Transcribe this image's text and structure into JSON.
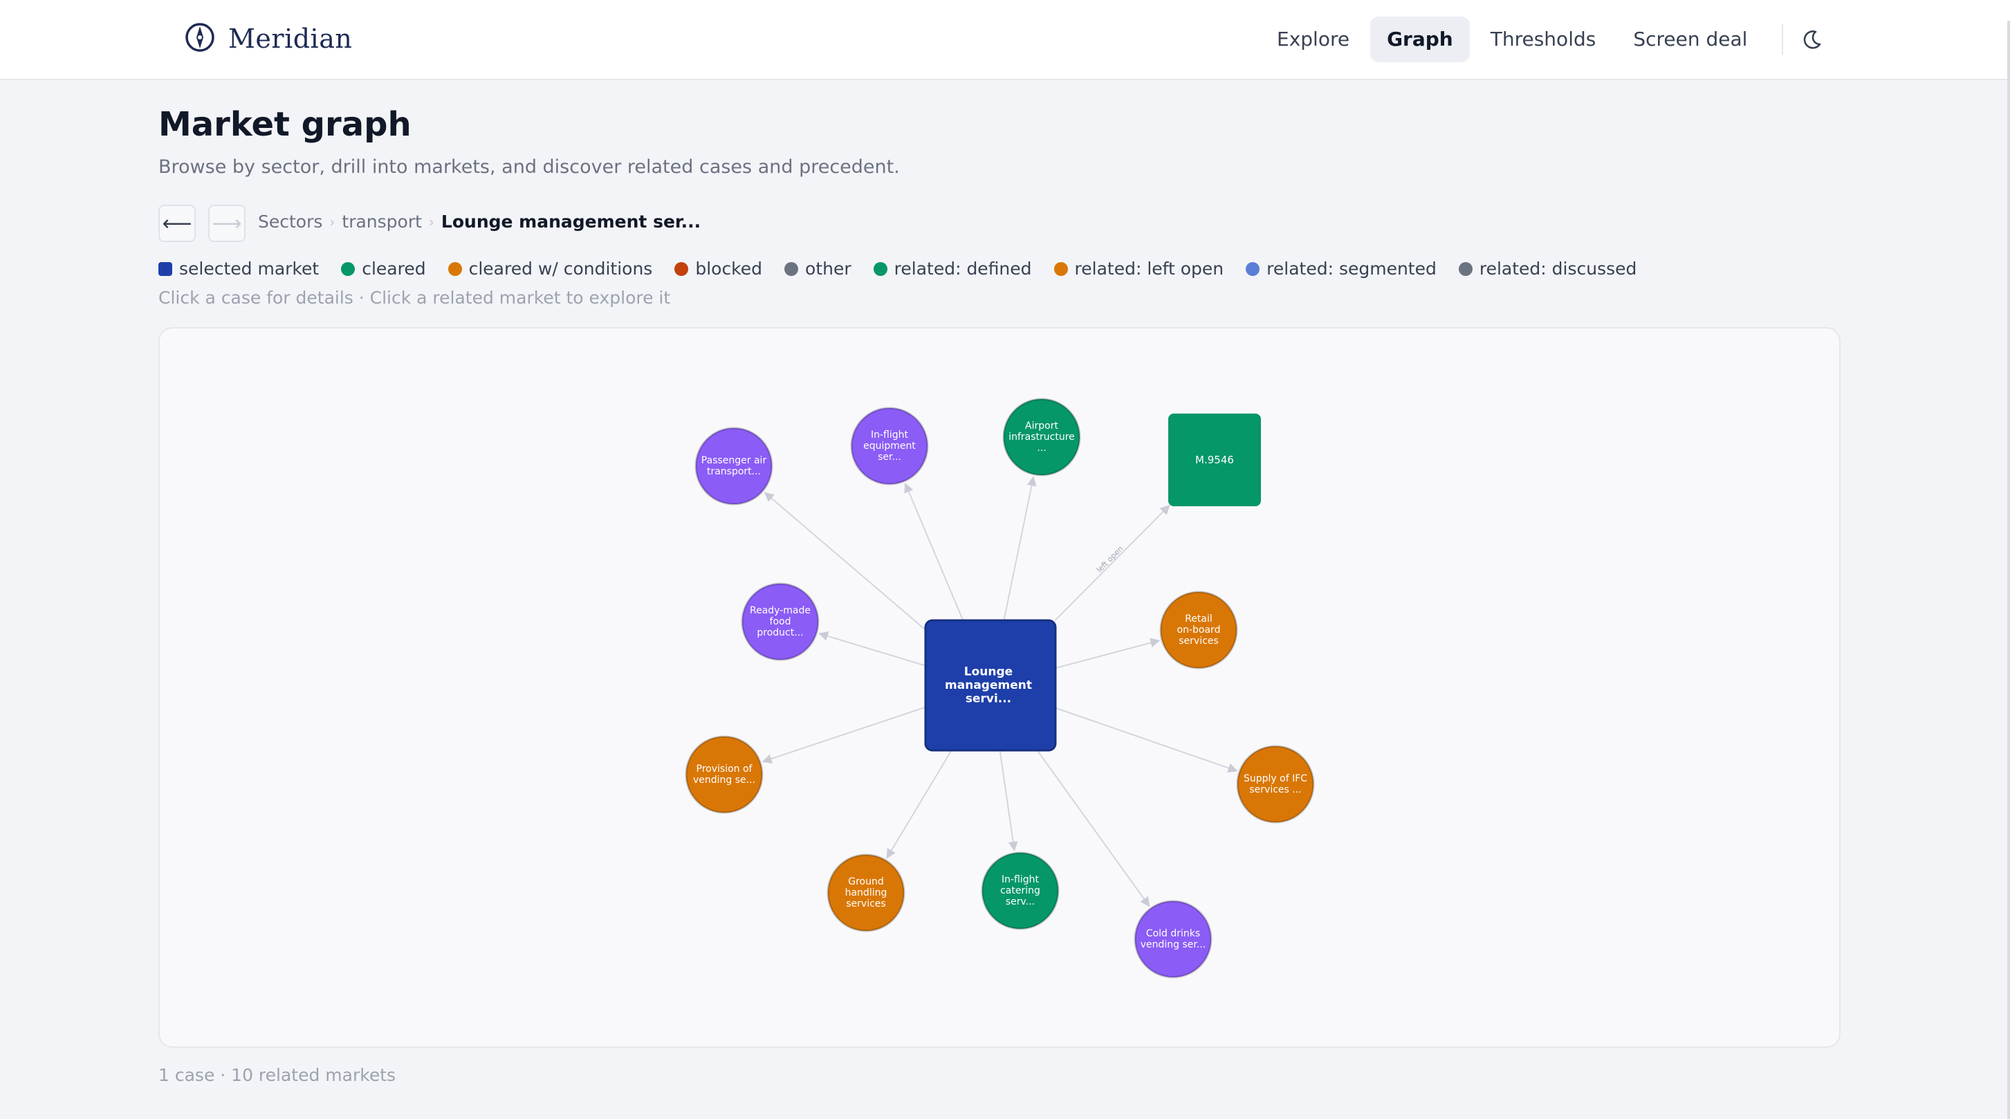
{
  "app": {
    "name": "Meridian"
  },
  "nav": {
    "items": [
      {
        "label": "Explore",
        "active": false
      },
      {
        "label": "Graph",
        "active": true
      },
      {
        "label": "Thresholds",
        "active": false
      },
      {
        "label": "Screen deal",
        "active": false
      }
    ],
    "theme_icon": "moon-icon"
  },
  "page": {
    "title": "Market graph",
    "subtitle": "Browse by sector, drill into markets, and discover related cases and precedent."
  },
  "breadcrumb": {
    "back_icon": "arrow-left-icon",
    "forward_icon": "arrow-right-icon",
    "items": [
      "Sectors",
      "transport"
    ],
    "current": "Lounge management ser..."
  },
  "legend": [
    {
      "label": "selected market",
      "color": "#1e3faa",
      "shape": "square"
    },
    {
      "label": "cleared",
      "color": "#059669",
      "shape": "circle"
    },
    {
      "label": "cleared w/ conditions",
      "color": "#d97706",
      "shape": "circle"
    },
    {
      "label": "blocked",
      "color": "#c2410c",
      "shape": "circle"
    },
    {
      "label": "other",
      "color": "#6b7280",
      "shape": "circle"
    },
    {
      "label": "related: defined",
      "color": "#059669",
      "shape": "circle"
    },
    {
      "label": "related: left open",
      "color": "#d97706",
      "shape": "circle"
    },
    {
      "label": "related: segmented",
      "color": "#5b7fd6",
      "shape": "circle"
    },
    {
      "label": "related: discussed",
      "color": "#6b7280",
      "shape": "circle"
    }
  ],
  "hint": "Click a case for details · Click a related market to explore it",
  "graph": {
    "center": {
      "label": "Lounge management servi...",
      "color": "#1e3faa"
    },
    "case": {
      "label": "M.9546",
      "color": "#059669",
      "edge_label": "left open"
    },
    "related": [
      {
        "label": "Passenger air transport...",
        "color": "#8b5cf6"
      },
      {
        "label": "In-flight equipment ser...",
        "color": "#8b5cf6"
      },
      {
        "label": "Airport infrastructure ...",
        "color": "#059669"
      },
      {
        "label": "Ready-made food product...",
        "color": "#8b5cf6"
      },
      {
        "label": "Retail on-board services",
        "color": "#d97706"
      },
      {
        "label": "Provision of vending se...",
        "color": "#d97706"
      },
      {
        "label": "Supply of IFC services ...",
        "color": "#d97706"
      },
      {
        "label": "Ground handling services",
        "color": "#d97706"
      },
      {
        "label": "In-flight catering serv...",
        "color": "#059669"
      },
      {
        "label": "Cold drinks vending ser...",
        "color": "#8b5cf6"
      }
    ]
  },
  "footer": {
    "stats": "1 case · 10 related markets"
  }
}
